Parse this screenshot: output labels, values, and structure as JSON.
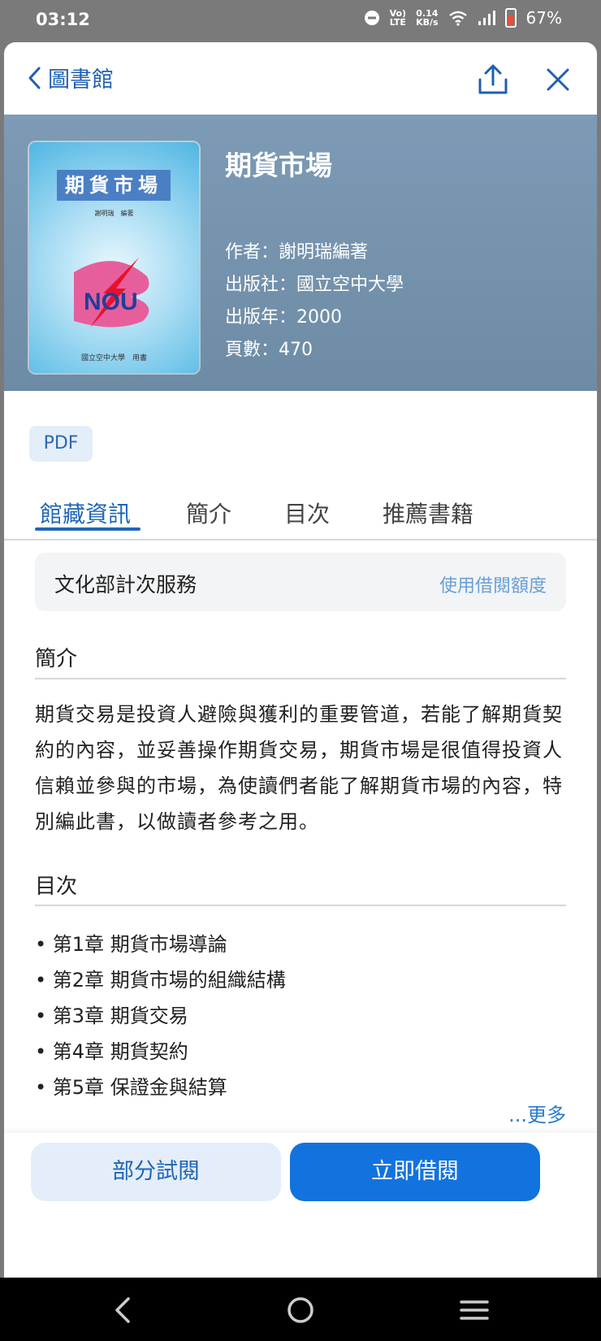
{
  "status_bar": {
    "time": "03:12",
    "network_top": "Vo)",
    "network_bottom": "LTE",
    "speed_top": "0.14",
    "speed_bottom": "KB/s",
    "battery": "67%"
  },
  "header": {
    "back_label": "圖書館"
  },
  "book": {
    "title": "期貨市場",
    "author": "作者：謝明瑞編著",
    "publisher": "出版社：國立空中大學",
    "year": "出版年：2000",
    "pages": "頁數：470",
    "cover": {
      "title": "期貨市場",
      "author": "謝明瑞　編著",
      "logo_text": "NOU",
      "publisher": "國立空中大學　用書"
    }
  },
  "format_tag": "PDF",
  "tabs": [
    {
      "label": "館藏資訊",
      "active": true
    },
    {
      "label": "簡介",
      "active": false
    },
    {
      "label": "目次",
      "active": false
    },
    {
      "label": "推薦書籍",
      "active": false
    }
  ],
  "service": {
    "label": "文化部計次服務",
    "action": "使用借閱額度"
  },
  "intro": {
    "heading": "簡介",
    "text": "期貨交易是投資人避險與獲利的重要管道，若能了解期貨契約的內容，並妥善操作期貨交易，期貨市場是很值得投資人信賴並參與的市場，為使讀們者能了解期貨市場的內容，特別編此書，以做讀者參考之用。"
  },
  "toc": {
    "heading": "目次",
    "items": [
      "第1章 期貨市場導論",
      "第2章 期貨市場的組織結構",
      "第3章 期貨交易",
      "第4章 期貨契約",
      "第5章 保證金與結算"
    ],
    "more": "...更多"
  },
  "actions": {
    "trial": "部分試閱",
    "borrow": "立即借閱"
  },
  "colors": {
    "accent": "#1273de",
    "hero_bg": "#7d9bb6"
  }
}
